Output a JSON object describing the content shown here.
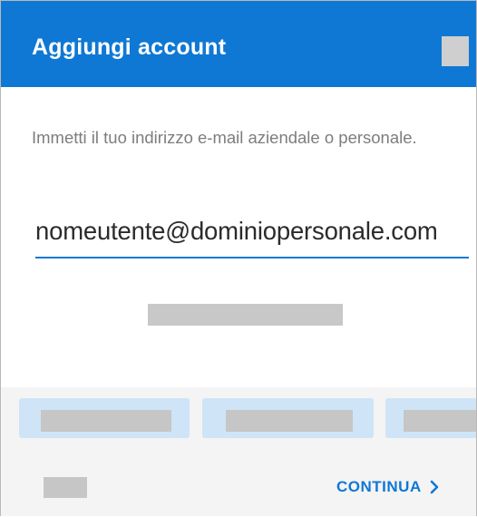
{
  "app_bar": {
    "title": "Aggiungi account",
    "accent_color": "#0f78d4",
    "menu_icon": "overflow-menu-icon"
  },
  "form": {
    "instruction": "Immetti il tuo indirizzo e-mail aziendale o personale.",
    "email_value": "nomeutente@dominiopersonale.com"
  },
  "footer": {
    "continue_label": "CONTINUA",
    "continue_icon": "chevron-right-icon"
  }
}
